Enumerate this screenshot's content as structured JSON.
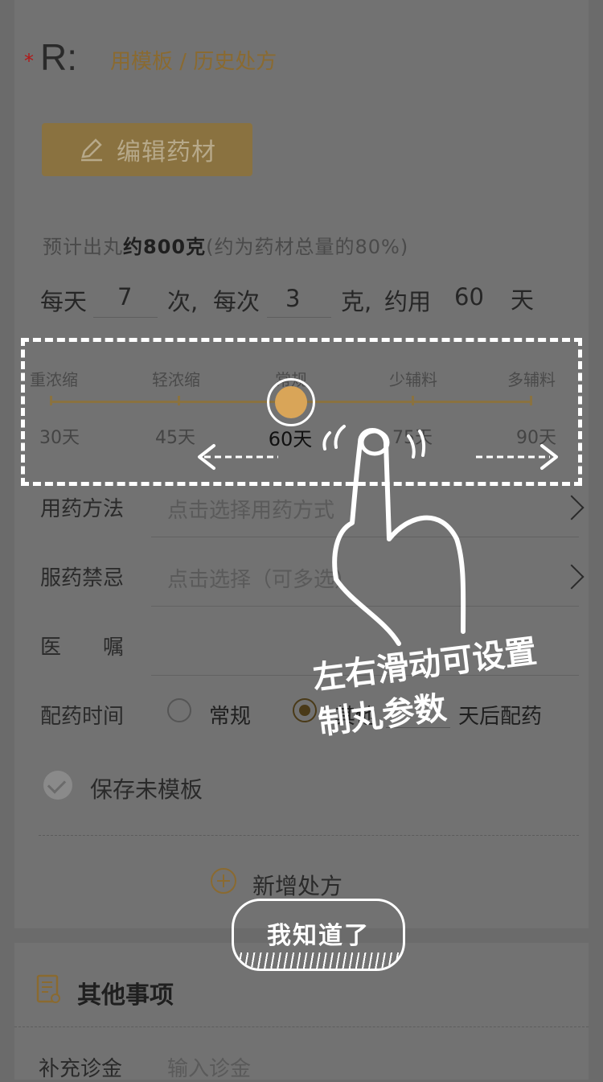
{
  "prescription": {
    "required_mark": "*",
    "label": "R:",
    "template_link": "用模板 / 历史处方",
    "edit_button": "编辑药材",
    "estimate_prefix": "预计出丸",
    "estimate_amount": "约800克",
    "estimate_suffix": "(约为药材总量的80%)",
    "dose": {
      "per_day_label": "每天",
      "times_value": "7",
      "times_unit": "次,",
      "per_time_label": "每次",
      "grams_value": "3",
      "grams_unit": "克,",
      "about_label": "约用",
      "days_value": "60",
      "days_unit": "天"
    }
  },
  "slider": {
    "levels": [
      "重浓缩",
      "轻浓缩",
      "常规",
      "少辅料",
      "多辅料"
    ],
    "days": [
      "30天",
      "45天",
      "60天",
      "75天",
      "90天"
    ],
    "selected_index": 2
  },
  "form": {
    "usage": {
      "label": "用药方法",
      "placeholder": "点击选择用药方式"
    },
    "taboo": {
      "label": "服药禁忌",
      "placeholder": "点击选择（可多选）"
    },
    "advice": {
      "label": "医　　嘱"
    },
    "dispense": {
      "label": "配药时间",
      "options": [
        "常规",
        "其他",
        "天后配药"
      ],
      "selected_index": 1
    },
    "save_template": "保存未模板",
    "add_prescription": "新增处方"
  },
  "guide": {
    "hint_line1": "左右滑动可设置",
    "hint_line2": "制丸参数",
    "confirm_button": "我知道了"
  },
  "other": {
    "title": "其他事项",
    "fee_label": "补充诊金",
    "fee_placeholder": "输入诊金"
  },
  "colors": {
    "accent_gold": "#d9a558",
    "overlay": "#6b6b6b"
  }
}
